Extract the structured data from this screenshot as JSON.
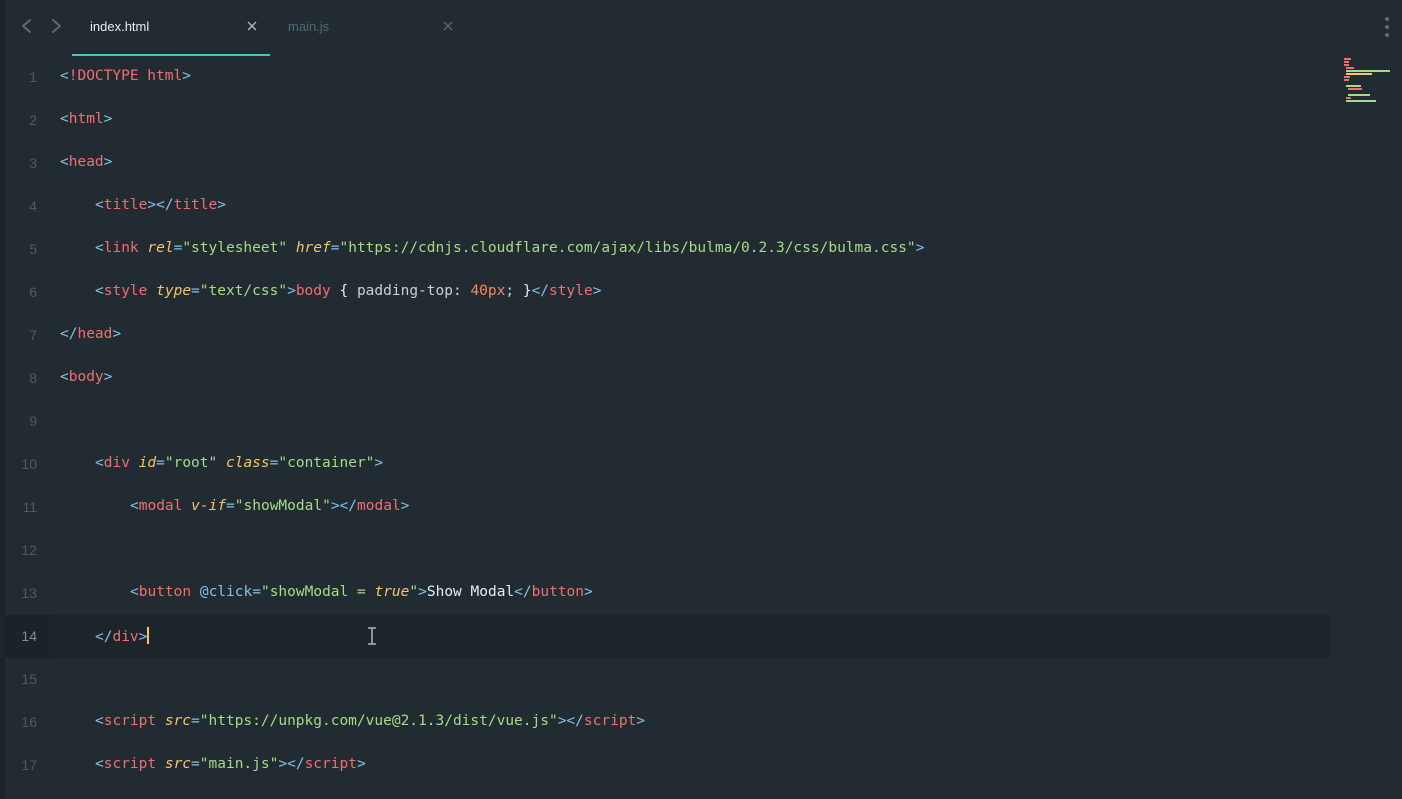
{
  "tabs": [
    {
      "label": "index.html",
      "active": true
    },
    {
      "label": "main.js",
      "active": false
    }
  ],
  "nav": {
    "back_icon": "chevron-left-icon",
    "forward_icon": "chevron-right-icon"
  },
  "more_icon": "vertical-ellipsis-icon",
  "colors": {
    "background": "#232b32",
    "accent": "#4dc3bd",
    "tag": "#ef6f71",
    "string": "#a6db85",
    "attribute": "#f3c56c"
  },
  "editor": {
    "current_line": 14,
    "lines": [
      {
        "n": "1",
        "indent": 0,
        "tokens": [
          {
            "t": "p",
            "v": "<"
          },
          {
            "t": "tag",
            "v": "!DOCTYPE html"
          },
          {
            "t": "p",
            "v": ">"
          }
        ]
      },
      {
        "n": "2",
        "indent": 0,
        "tokens": [
          {
            "t": "p",
            "v": "<"
          },
          {
            "t": "tag",
            "v": "html"
          },
          {
            "t": "p",
            "v": ">"
          }
        ]
      },
      {
        "n": "3",
        "indent": 0,
        "tokens": [
          {
            "t": "p",
            "v": "<"
          },
          {
            "t": "tag",
            "v": "head"
          },
          {
            "t": "p",
            "v": ">"
          }
        ]
      },
      {
        "n": "4",
        "indent": 1,
        "tokens": [
          {
            "t": "p",
            "v": "<"
          },
          {
            "t": "tag",
            "v": "title"
          },
          {
            "t": "p",
            "v": "></"
          },
          {
            "t": "tag",
            "v": "title"
          },
          {
            "t": "p",
            "v": ">"
          }
        ]
      },
      {
        "n": "5",
        "indent": 1,
        "tokens": [
          {
            "t": "p",
            "v": "<"
          },
          {
            "t": "tag",
            "v": "link "
          },
          {
            "t": "attr",
            "v": "rel"
          },
          {
            "t": "eq",
            "v": "="
          },
          {
            "t": "str",
            "v": "\"stylesheet\""
          },
          {
            "t": "text",
            "v": " "
          },
          {
            "t": "attr",
            "v": "href"
          },
          {
            "t": "eq",
            "v": "="
          },
          {
            "t": "str",
            "v": "\"https://cdnjs.cloudflare.com/ajax/libs/bulma/0.2.3/css/bulma.css\""
          },
          {
            "t": "p",
            "v": ">"
          }
        ]
      },
      {
        "n": "6",
        "indent": 1,
        "tokens": [
          {
            "t": "p",
            "v": "<"
          },
          {
            "t": "tag",
            "v": "style "
          },
          {
            "t": "attr",
            "v": "type"
          },
          {
            "t": "eq",
            "v": "="
          },
          {
            "t": "str",
            "v": "\"text/css\""
          },
          {
            "t": "p",
            "v": ">"
          },
          {
            "t": "tag",
            "v": "body "
          },
          {
            "t": "brace",
            "v": "{ "
          },
          {
            "t": "prop",
            "v": "padding-top: "
          },
          {
            "t": "num",
            "v": "40px"
          },
          {
            "t": "prop",
            "v": "; "
          },
          {
            "t": "brace",
            "v": "}"
          },
          {
            "t": "p",
            "v": "</"
          },
          {
            "t": "tag",
            "v": "style"
          },
          {
            "t": "p",
            "v": ">"
          }
        ]
      },
      {
        "n": "7",
        "indent": 0,
        "tokens": [
          {
            "t": "p",
            "v": "</"
          },
          {
            "t": "tag",
            "v": "head"
          },
          {
            "t": "p",
            "v": ">"
          }
        ]
      },
      {
        "n": "8",
        "indent": 0,
        "tokens": [
          {
            "t": "p",
            "v": "<"
          },
          {
            "t": "tag",
            "v": "body"
          },
          {
            "t": "p",
            "v": ">"
          }
        ]
      },
      {
        "n": "9",
        "indent": 0,
        "tokens": []
      },
      {
        "n": "10",
        "indent": 1,
        "tokens": [
          {
            "t": "p",
            "v": "<"
          },
          {
            "t": "tag",
            "v": "div "
          },
          {
            "t": "attr",
            "v": "id"
          },
          {
            "t": "eq",
            "v": "="
          },
          {
            "t": "str",
            "v": "\"root\""
          },
          {
            "t": "text",
            "v": " "
          },
          {
            "t": "attr",
            "v": "class"
          },
          {
            "t": "eq",
            "v": "="
          },
          {
            "t": "str",
            "v": "\"container\""
          },
          {
            "t": "p",
            "v": ">"
          }
        ]
      },
      {
        "n": "11",
        "indent": 2,
        "tokens": [
          {
            "t": "p",
            "v": "<"
          },
          {
            "t": "tag",
            "v": "modal "
          },
          {
            "t": "attr",
            "v": "v-if"
          },
          {
            "t": "eq",
            "v": "="
          },
          {
            "t": "str",
            "v": "\"showModal\""
          },
          {
            "t": "p",
            "v": "></"
          },
          {
            "t": "tag",
            "v": "modal"
          },
          {
            "t": "p",
            "v": ">"
          }
        ]
      },
      {
        "n": "12",
        "indent": 0,
        "tokens": []
      },
      {
        "n": "13",
        "indent": 2,
        "tokens": [
          {
            "t": "p",
            "v": "<"
          },
          {
            "t": "tag",
            "v": "button "
          },
          {
            "t": "dir",
            "v": "@click"
          },
          {
            "t": "eq",
            "v": "="
          },
          {
            "t": "str",
            "v": "\"showModal = "
          },
          {
            "t": "bool",
            "v": "true"
          },
          {
            "t": "str",
            "v": "\""
          },
          {
            "t": "p",
            "v": ">"
          },
          {
            "t": "text",
            "v": "Show Modal"
          },
          {
            "t": "p",
            "v": "</"
          },
          {
            "t": "tag",
            "v": "button"
          },
          {
            "t": "p",
            "v": ">"
          }
        ]
      },
      {
        "n": "14",
        "indent": 1,
        "tokens": [
          {
            "t": "p",
            "v": "</"
          },
          {
            "t": "tag",
            "v": "div"
          },
          {
            "t": "p",
            "v": ">"
          }
        ],
        "caret": true
      },
      {
        "n": "15",
        "indent": 0,
        "tokens": []
      },
      {
        "n": "16",
        "indent": 1,
        "tokens": [
          {
            "t": "p",
            "v": "<"
          },
          {
            "t": "tag",
            "v": "script "
          },
          {
            "t": "attr",
            "v": "src"
          },
          {
            "t": "eq",
            "v": "="
          },
          {
            "t": "str",
            "v": "\"https://unpkg.com/vue@2.1.3/dist/vue.js\""
          },
          {
            "t": "p",
            "v": "></"
          },
          {
            "t": "tag",
            "v": "script"
          },
          {
            "t": "p",
            "v": ">"
          }
        ]
      },
      {
        "n": "17",
        "indent": 1,
        "tokens": [
          {
            "t": "p",
            "v": "<"
          },
          {
            "t": "tag",
            "v": "script "
          },
          {
            "t": "attr",
            "v": "src"
          },
          {
            "t": "eq",
            "v": "="
          },
          {
            "t": "str",
            "v": "\"main.js\""
          },
          {
            "t": "p",
            "v": "></"
          },
          {
            "t": "tag",
            "v": "script"
          },
          {
            "t": "p",
            "v": ">"
          }
        ]
      }
    ]
  }
}
